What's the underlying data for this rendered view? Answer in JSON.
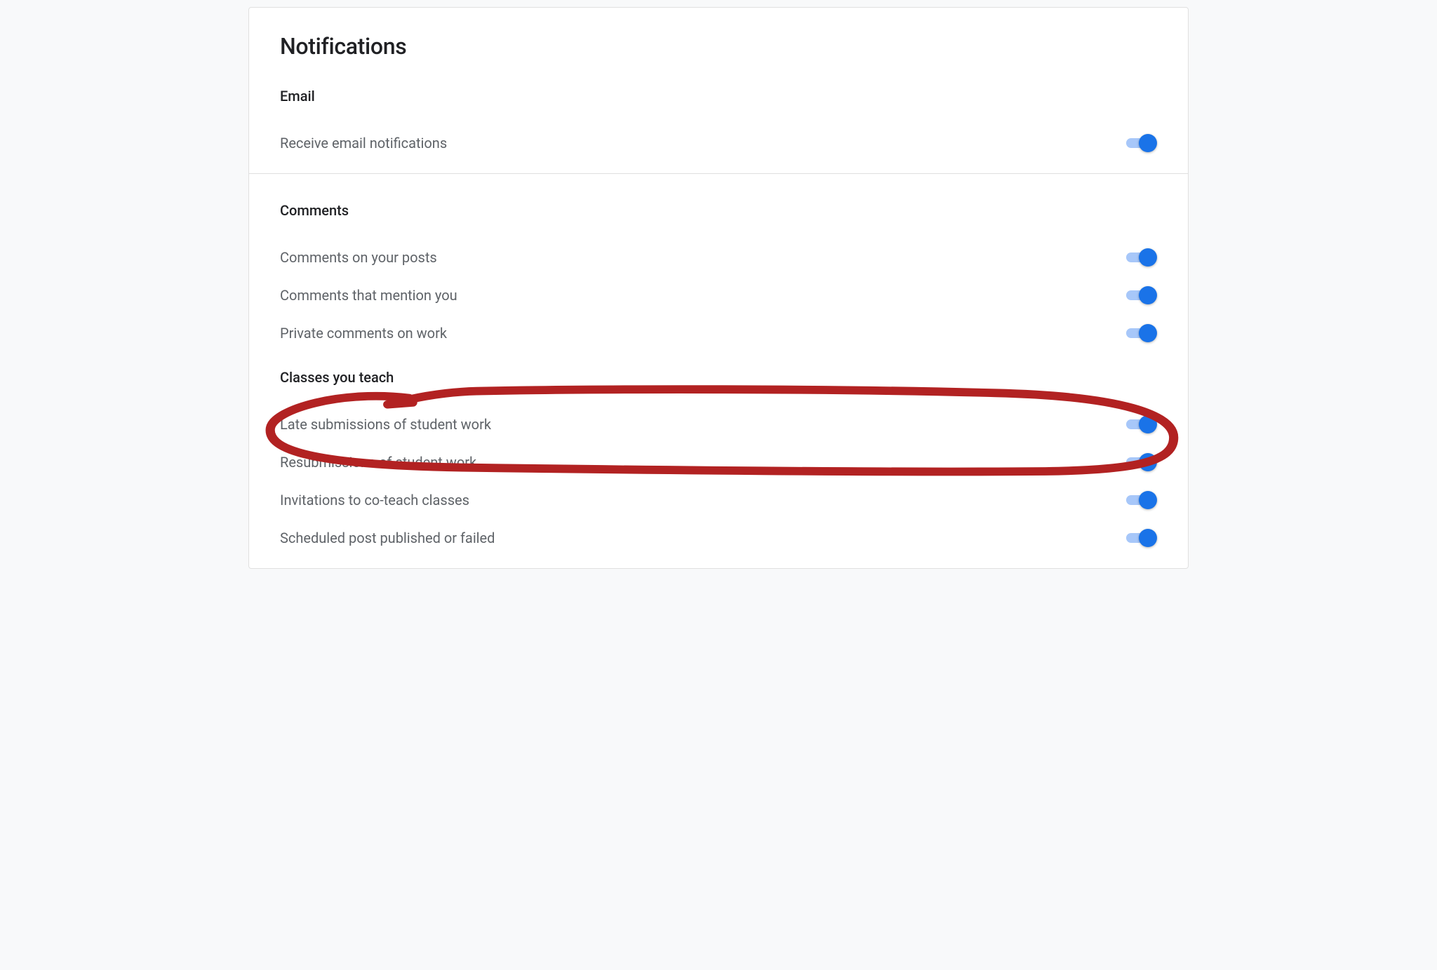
{
  "page": {
    "title": "Notifications"
  },
  "sections": {
    "email": {
      "title": "Email",
      "rows": {
        "receive_email": {
          "label": "Receive email notifications",
          "on": true
        }
      }
    },
    "comments": {
      "title": "Comments",
      "rows": {
        "on_posts": {
          "label": "Comments on your posts",
          "on": true
        },
        "mention_you": {
          "label": "Comments that mention you",
          "on": true
        },
        "private_on_work": {
          "label": "Private comments on work",
          "on": true
        }
      }
    },
    "classes_teach": {
      "title": "Classes you teach",
      "rows": {
        "late_submissions": {
          "label": "Late submissions of student work",
          "on": true
        },
        "resubmissions": {
          "label": "Resubmissions of student work",
          "on": true
        },
        "coteach_invites": {
          "label": "Invitations to co-teach classes",
          "on": true
        },
        "scheduled_post": {
          "label": "Scheduled post published or failed",
          "on": true
        }
      }
    }
  },
  "annotation": {
    "color": "#b22222",
    "target": "late_submissions"
  }
}
